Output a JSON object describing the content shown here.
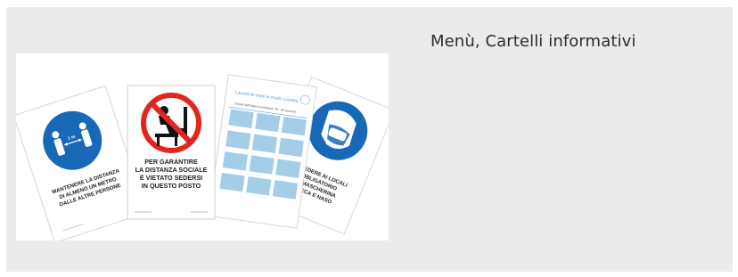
{
  "card": {
    "title": "Menù, Cartelli informativi"
  },
  "signs": {
    "distance": {
      "lines": [
        "MANTENERE LA DISTANZA",
        "DI ALMENO UN METRO",
        "DALLE ALTRE PERSONE"
      ],
      "meter_label": "1 m",
      "icon": "social-distance-icon",
      "color": "#1769b8"
    },
    "no_sitting": {
      "lines": [
        "PER GARANTIRE",
        "LA DISTANZA SOCIALE",
        "È VIETATO SEDERSI",
        "IN QUESTO POSTO"
      ],
      "icon": "no-sitting-icon",
      "color": "#e0261f"
    },
    "handwash": {
      "title": "Lavarsi le mani in modo corretto",
      "subtitle": "Durata dell'intera procedura: 40 - 60 secondi",
      "icon": "handwash-steps-icon",
      "color": "#5aa6d6"
    },
    "mask": {
      "lines": [
        "ACCEDERE AI LOCALI",
        "OBBLIGATORIO",
        "LA MASCHERINA",
        "BOCCA E NASO"
      ],
      "icon": "face-mask-icon",
      "color": "#1769b8"
    }
  }
}
